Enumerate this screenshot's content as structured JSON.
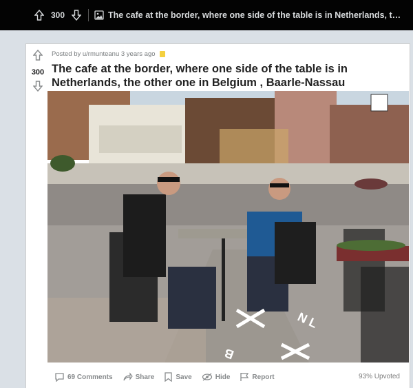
{
  "topbar": {
    "score": "300",
    "title": "The cafe at the border, where one side of the table is in Netherlands, the other one in Belgiu..."
  },
  "post": {
    "posted_by": "Posted by u/rmunteanu 3 years ago",
    "score": "300",
    "title": "The cafe at the border, where one side of the table is in Netherlands, the other one in Belgium , Baarle-Nassau",
    "image_alt": "Two men sitting at a cafe table on the Belgium–Netherlands border with N L and B markings on the pavement"
  },
  "actions": {
    "comments": "69 Comments",
    "share": "Share",
    "save": "Save",
    "hide": "Hide",
    "report": "Report",
    "upvoted": "93% Upvoted"
  },
  "colors": {
    "topbar_bg": "#030303",
    "page_bg": "#dae0e6",
    "card_bg": "#ffffff",
    "meta_text": "#787c7e",
    "action_text": "#878a8c"
  }
}
